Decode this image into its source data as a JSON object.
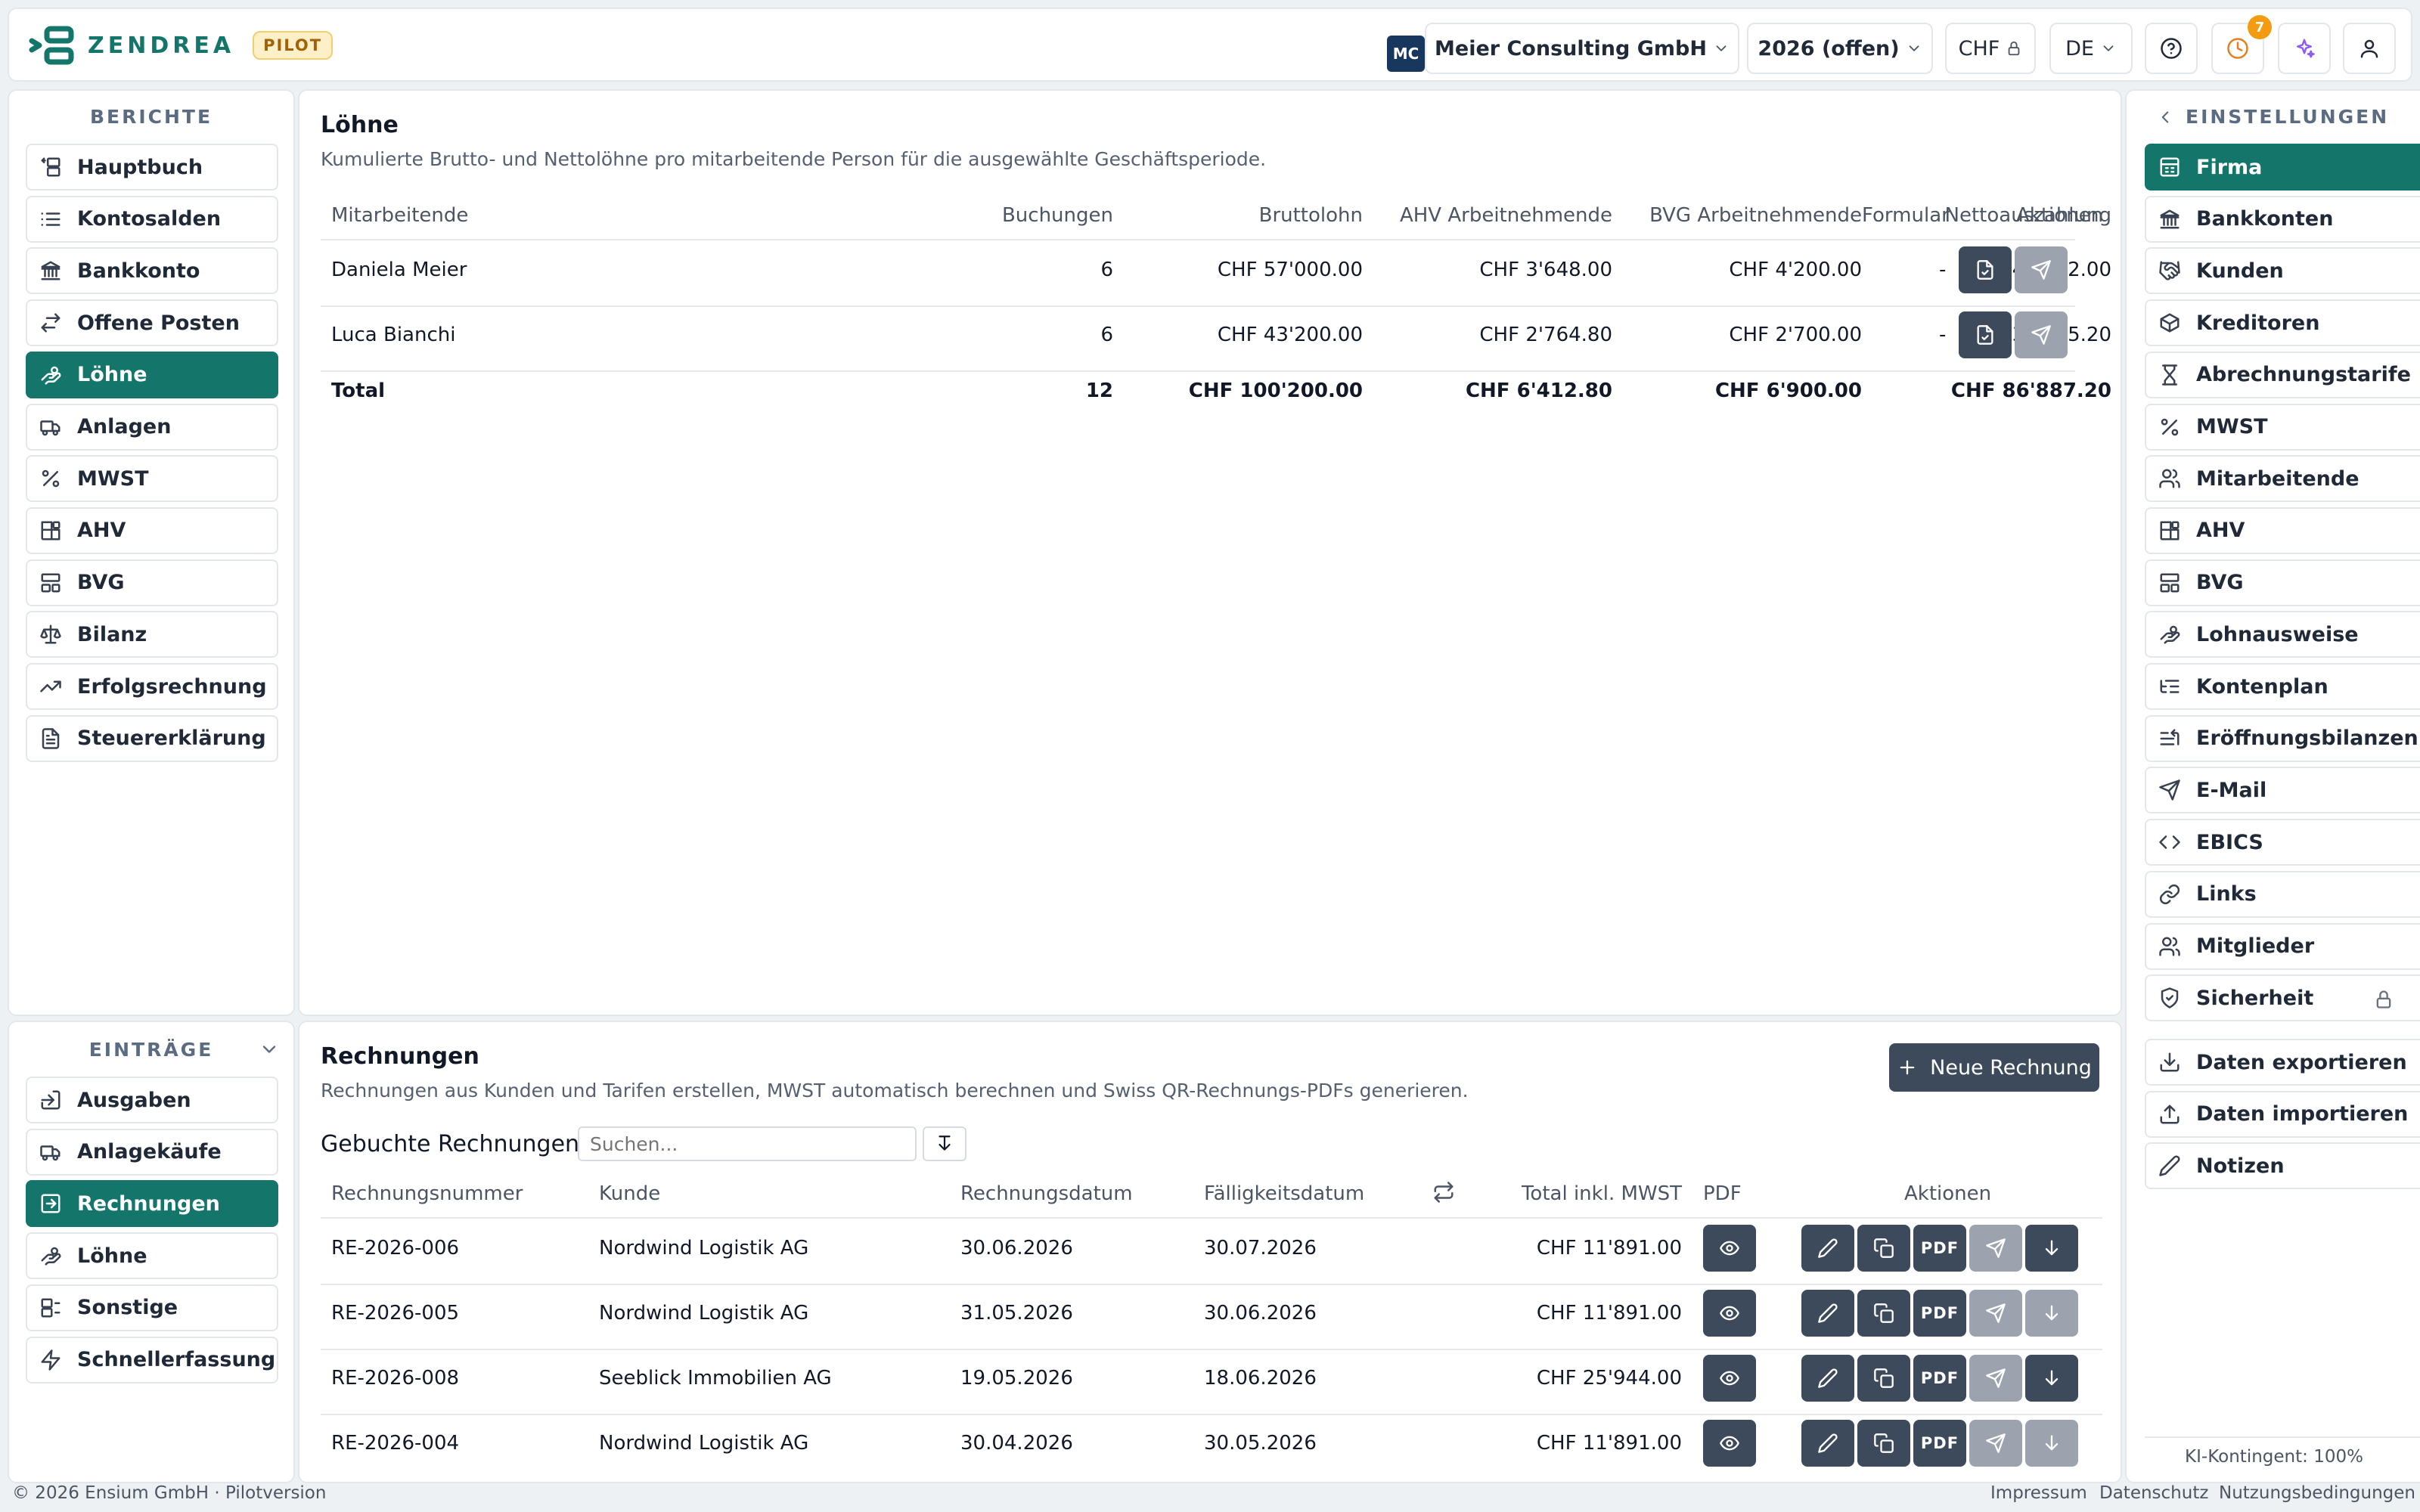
{
  "header": {
    "brand": "ZENDREA",
    "pilot_badge": "PILOT",
    "company_initials": "MC",
    "company": "Meier Consulting GmbH",
    "period": "2026 (offen)",
    "currency": "CHF",
    "language": "DE",
    "notification_count": "7"
  },
  "left_sidebar": {
    "reports_title": "BERICHTE",
    "reports": [
      {
        "label": "Hauptbuch",
        "icon": "ledger-icon"
      },
      {
        "label": "Kontosalden",
        "icon": "list-icon"
      },
      {
        "label": "Bankkonto",
        "icon": "bank-icon"
      },
      {
        "label": "Offene Posten",
        "icon": "arrows-icon"
      },
      {
        "label": "Löhne",
        "icon": "payroll-icon"
      },
      {
        "label": "Anlagen",
        "icon": "truck-icon"
      },
      {
        "label": "MWST",
        "icon": "percent-icon"
      },
      {
        "label": "AHV",
        "icon": "blocks-icon"
      },
      {
        "label": "BVG",
        "icon": "layout-icon"
      },
      {
        "label": "Bilanz",
        "icon": "scale-icon"
      },
      {
        "label": "Erfolgsrechnung",
        "icon": "trend-icon"
      },
      {
        "label": "Steuererklärung",
        "icon": "document-icon"
      }
    ],
    "entries_title": "EINTRÄGE",
    "entries": [
      {
        "label": "Ausgaben",
        "icon": "exit-icon"
      },
      {
        "label": "Anlagekäufe",
        "icon": "truck-icon"
      },
      {
        "label": "Rechnungen",
        "icon": "invoice-icon"
      },
      {
        "label": "Löhne",
        "icon": "payroll-icon"
      },
      {
        "label": "Sonstige",
        "icon": "other-icon"
      },
      {
        "label": "Schnellerfassung",
        "icon": "bolt-icon"
      }
    ]
  },
  "wages": {
    "title": "Löhne",
    "subtitle": "Kumulierte Brutto- und Nettolöhne pro mitarbeitende Person für die ausgewählte Geschäftsperiode.",
    "columns": [
      "Mitarbeitende",
      "Buchungen",
      "Bruttolohn",
      "AHV Arbeitnehmende",
      "BVG Arbeitnehmende",
      "Nettoauszahlung",
      "Formular",
      "Aktionen"
    ],
    "rows": [
      {
        "name": "Daniela Meier",
        "bookings": "6",
        "gross": "CHF 57'000.00",
        "ahv": "CHF 3'648.00",
        "bvg": "CHF 4'200.00",
        "net": "CHF 49'152.00",
        "form": "-"
      },
      {
        "name": "Luca Bianchi",
        "bookings": "6",
        "gross": "CHF 43'200.00",
        "ahv": "CHF 2'764.80",
        "bvg": "CHF 2'700.00",
        "net": "CHF 37'735.20",
        "form": "-"
      }
    ],
    "total": {
      "label": "Total",
      "bookings": "12",
      "gross": "CHF 100'200.00",
      "ahv": "CHF 6'412.80",
      "bvg": "CHF 6'900.00",
      "net": "CHF 86'887.20"
    }
  },
  "invoices": {
    "title": "Rechnungen",
    "subtitle": "Rechnungen aus Kunden und Tarifen erstellen, MWST automatisch berechnen und Swiss QR-Rechnungs-PDFs generieren.",
    "new_button": "Neue Rechnung",
    "list_title": "Gebuchte Rechnungen",
    "search_placeholder": "Suchen...",
    "columns": [
      "Rechnungsnummer",
      "Kunde",
      "Rechnungsdatum",
      "Fälligkeitsdatum",
      "Total inkl. MWST",
      "PDF",
      "Aktionen"
    ],
    "pdf_label": "PDF",
    "rows": [
      {
        "number": "RE-2026-006",
        "customer": "Nordwind Logistik AG",
        "date": "30.06.2026",
        "due": "30.07.2026",
        "total": "CHF 11'891.00"
      },
      {
        "number": "RE-2026-005",
        "customer": "Nordwind Logistik AG",
        "date": "31.05.2026",
        "due": "30.06.2026",
        "total": "CHF 11'891.00"
      },
      {
        "number": "RE-2026-008",
        "customer": "Seeblick Immobilien AG",
        "date": "19.05.2026",
        "due": "18.06.2026",
        "total": "CHF 25'944.00"
      },
      {
        "number": "RE-2026-004",
        "customer": "Nordwind Logistik AG",
        "date": "30.04.2026",
        "due": "30.05.2026",
        "total": "CHF 11'891.00"
      }
    ]
  },
  "right_sidebar": {
    "title": "EINSTELLUNGEN",
    "items": [
      {
        "label": "Firma",
        "icon": "building-icon"
      },
      {
        "label": "Bankkonten",
        "icon": "bank-icon"
      },
      {
        "label": "Kunden",
        "icon": "handshake-icon"
      },
      {
        "label": "Kreditoren",
        "icon": "package-icon"
      },
      {
        "label": "Abrechnungstarife",
        "icon": "hourglass-icon"
      },
      {
        "label": "MWST",
        "icon": "percent-icon"
      },
      {
        "label": "Mitarbeitende",
        "icon": "users-icon"
      },
      {
        "label": "AHV",
        "icon": "blocks-icon"
      },
      {
        "label": "BVG",
        "icon": "layout-icon"
      },
      {
        "label": "Lohnausweise",
        "icon": "payroll-icon"
      },
      {
        "label": "Kontenplan",
        "icon": "list-tree-icon"
      },
      {
        "label": "Eröffnungsbilanzen",
        "icon": "list-start-icon"
      },
      {
        "label": "E-Mail",
        "icon": "send-icon"
      },
      {
        "label": "EBICS",
        "icon": "code-icon"
      },
      {
        "label": "Links",
        "icon": "link-icon"
      },
      {
        "label": "Mitglieder",
        "icon": "users-icon"
      },
      {
        "label": "Sicherheit",
        "icon": "shield-icon"
      }
    ],
    "data_items": [
      {
        "label": "Daten exportieren",
        "icon": "download-icon"
      },
      {
        "label": "Daten importieren",
        "icon": "upload-icon"
      },
      {
        "label": "Notizen",
        "icon": "pencil-icon"
      }
    ],
    "quota": "KI-Kontingent: 100%"
  },
  "footer": {
    "copyright": "© 2026 Ensium GmbH · Pilotversion",
    "links": [
      "Impressum",
      "Datenschutz",
      "Nutzungsbedingungen"
    ]
  },
  "colors": {
    "accent": "#14766a",
    "action_button": "#3c4a5c",
    "disabled_button": "#9ca3af",
    "badge": "#f39c12"
  }
}
